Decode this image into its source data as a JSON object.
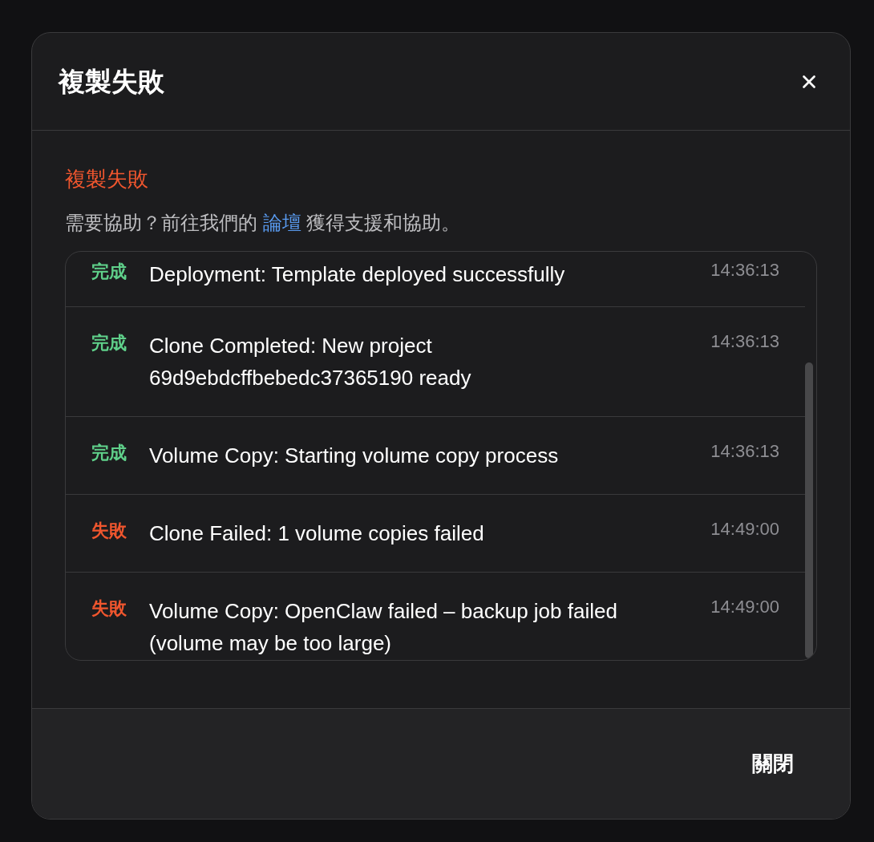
{
  "dialog": {
    "title": "複製失敗",
    "close_label": "關閉"
  },
  "status": {
    "heading": "複製失敗",
    "help_before": "需要協助？前往我們的",
    "help_link": "論壇",
    "help_after": "獲得支援和協助。"
  },
  "log": [
    {
      "kind": "success",
      "label": "完成",
      "message": "Deployment: Template deployed successfully",
      "time": "14:36:13"
    },
    {
      "kind": "success",
      "label": "完成",
      "message": "Clone Completed: New project 69d9ebdcffbebedc37365190 ready",
      "time": "14:36:13"
    },
    {
      "kind": "success",
      "label": "完成",
      "message": "Volume Copy: Starting volume copy process",
      "time": "14:36:13"
    },
    {
      "kind": "failure",
      "label": "失敗",
      "message": "Clone Failed: 1 volume copies failed",
      "time": "14:49:00"
    },
    {
      "kind": "failure",
      "label": "失敗",
      "message": "Volume Copy: OpenClaw failed – backup job failed (volume may be too large)",
      "time": "14:49:00"
    }
  ]
}
